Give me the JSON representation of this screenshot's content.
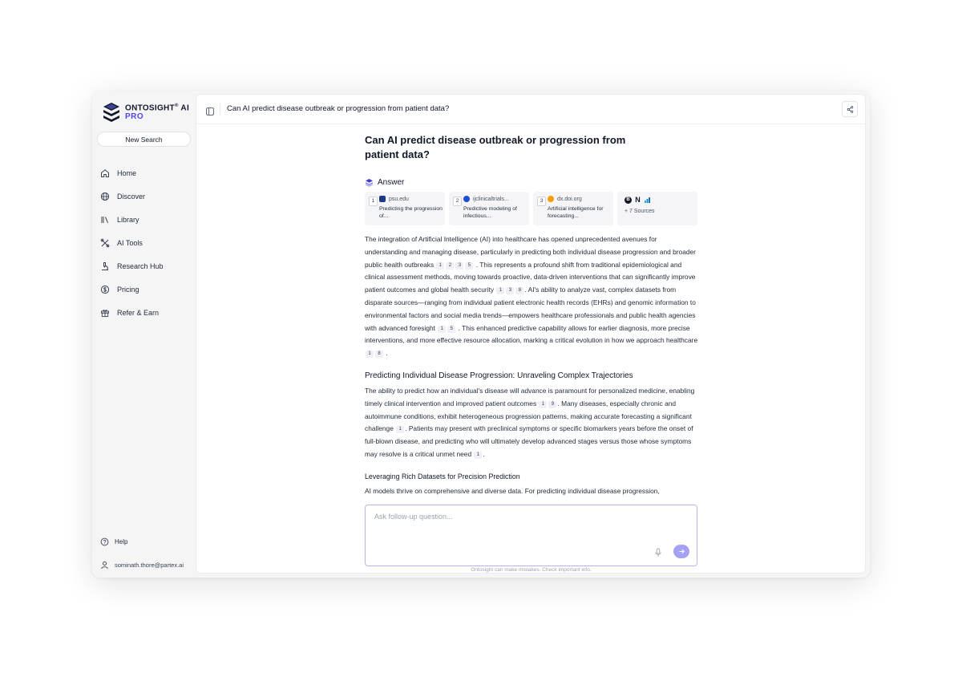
{
  "brand": {
    "name": "ONTOSIGHT",
    "mark": "®",
    "suffix": "AI",
    "tier": "PRO"
  },
  "sidebar": {
    "new_search": "New Search",
    "items": [
      {
        "label": "Home",
        "icon": "home-icon"
      },
      {
        "label": "Discover",
        "icon": "globe-icon"
      },
      {
        "label": "Library",
        "icon": "library-icon"
      },
      {
        "label": "AI Tools",
        "icon": "tools-icon"
      },
      {
        "label": "Research Hub",
        "icon": "microscope-icon"
      },
      {
        "label": "Pricing",
        "icon": "dollar-icon"
      },
      {
        "label": "Refer & Earn",
        "icon": "gift-icon"
      }
    ],
    "help": "Help",
    "user_email": "sominath.thore@partex.ai"
  },
  "topbar": {
    "title": "Can AI predict disease outbreak or progression from patient data?"
  },
  "question": "Can AI predict disease outbreak or progression from patient data?",
  "answer_label": "Answer",
  "sources": [
    {
      "num": "1",
      "domain": "psu.edu",
      "title": "Predicting the progression of...",
      "color": "#1e3a8a"
    },
    {
      "num": "2",
      "domain": "ijclinicaltrials...",
      "title": "Predictive modeling of infectious...",
      "color": "#1d4ed8"
    },
    {
      "num": "3",
      "domain": "dx.doi.org",
      "title": "Artificial intelligence for forecasting...",
      "color": "#f59e0b"
    }
  ],
  "more_sources": {
    "label": "+ 7 Sources",
    "icons": [
      "B",
      "N",
      "chart"
    ]
  },
  "body": {
    "p1": {
      "t1": "The integration of Artificial Intelligence (AI) into healthcare has opened unprecedented avenues for understanding and managing disease, particularly in predicting both individual disease progression and broader public health outbreaks",
      "c1": [
        "1",
        "2",
        "3",
        "5"
      ],
      "t2": ". This represents a profound shift from traditional epidemiological and clinical assessment methods, moving towards proactive, data-driven interventions that can significantly improve patient outcomes and global health security",
      "c2": [
        "1",
        "3",
        "8"
      ],
      "t3": ". AI's ability to analyze vast, complex datasets from disparate sources—ranging from individual patient electronic health records (EHRs) and genomic information to environmental factors and social media trends—empowers healthcare professionals and public health agencies with advanced foresight",
      "c3": [
        "1",
        "5"
      ],
      "t4": ". This enhanced predictive capability allows for earlier diagnosis, more precise interventions, and more effective resource allocation, marking a critical evolution in how we approach healthcare",
      "c4": [
        "1",
        "8"
      ],
      "t5": "."
    },
    "h2": "Predicting Individual Disease Progression: Unraveling Complex Trajectories",
    "p2": {
      "t1": "The ability to predict how an individual's disease will advance is paramount for personalized medicine, enabling timely clinical intervention and improved patient outcomes",
      "c1": [
        "1",
        "9"
      ],
      "t2": ". Many diseases, especially chronic and autoimmune conditions, exhibit heterogeneous progression patterns, making accurate forecasting a significant challenge",
      "c2": [
        "1"
      ],
      "t3": ". Patients may present with preclinical symptoms or specific biomarkers years before the onset of full-blown disease, and predicting who will ultimately develop advanced stages versus those whose symptoms may resolve is a critical unmet need",
      "c3": [
        "1"
      ],
      "t4": "."
    },
    "h3": "Leveraging Rich Datasets for Precision Prediction",
    "p3": "AI models thrive on comprehensive and diverse data. For predicting individual disease progression,"
  },
  "ask": {
    "placeholder": "Ask follow-up question...",
    "value": ""
  },
  "disclaimer": "Ontosight can make mistakes. Check important info."
}
